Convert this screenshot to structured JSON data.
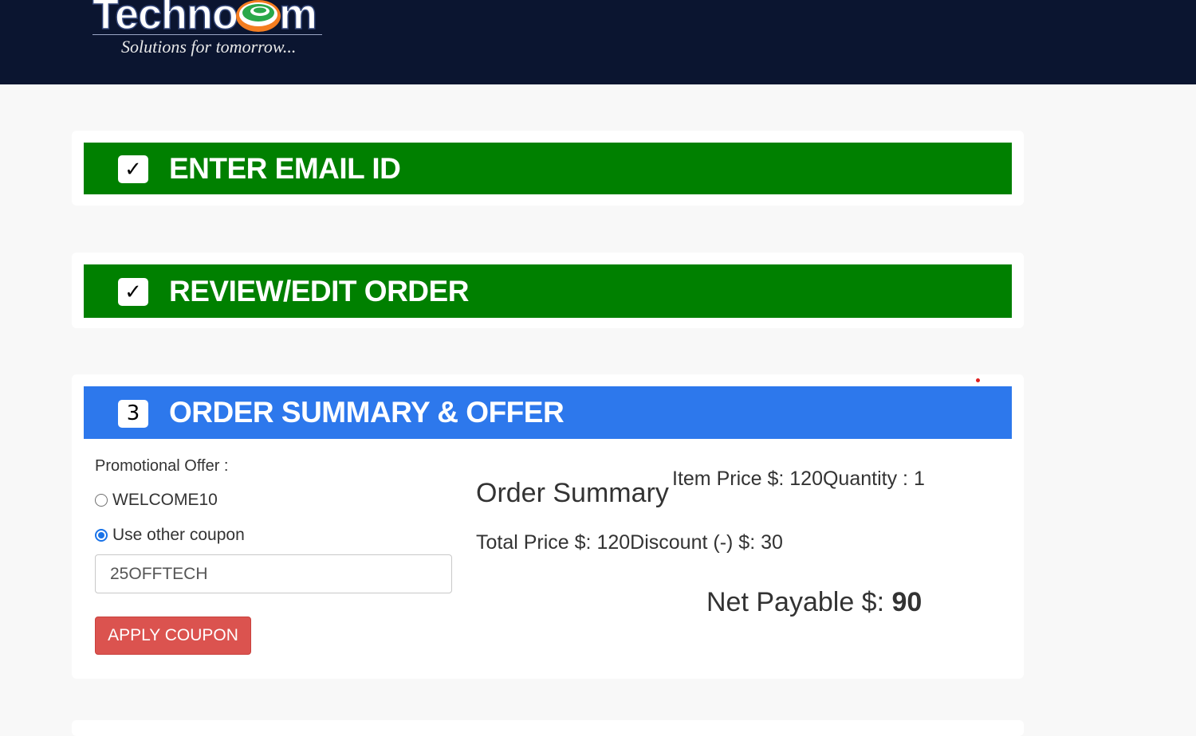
{
  "header": {
    "logo": {
      "brand": "Technocom",
      "tagline": "Solutions for tomorrow..."
    }
  },
  "steps": [
    {
      "marker": "✓",
      "title": "ENTER EMAIL ID",
      "status": "completed"
    },
    {
      "marker": "✓",
      "title": "REVIEW/EDIT ORDER",
      "status": "completed"
    },
    {
      "marker": "3",
      "title": "ORDER SUMMARY & OFFER",
      "status": "active"
    }
  ],
  "offer": {
    "label": "Promotional Offer :",
    "options": [
      {
        "label": "WELCOME10",
        "selected": false
      },
      {
        "label": "Use other coupon",
        "selected": true
      }
    ],
    "coupon_value": "25OFFTECH",
    "apply_label": "APPLY COUPON"
  },
  "summary": {
    "title": "Order Summary",
    "item_price_label": "Item Price $: ",
    "item_price": "120",
    "quantity_label": "Quantity : ",
    "quantity": "1",
    "total_price_label": "Total Price $: ",
    "total_price": "120",
    "discount_label": "Discount (-) $: ",
    "discount": "30",
    "net_label": "Net Payable $: ",
    "net_value": "90"
  },
  "colors": {
    "header_bg": "#0b1530",
    "completed_step": "#008000",
    "active_step": "#2d78ec",
    "apply_button": "#db534f",
    "page_bg": "#f8f8f8"
  }
}
